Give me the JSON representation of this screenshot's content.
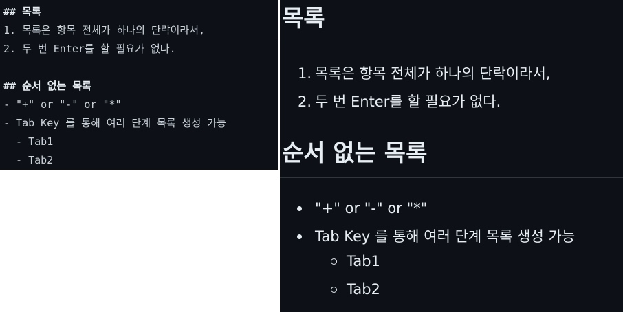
{
  "source": {
    "lines": [
      "## 목록",
      "1. 목록은 항목 전체가 하나의 단락이라서,",
      "2. 두 번 Enter를 할 필요가 없다.",
      "",
      "## 순서 없는 목록",
      "- \"+\" or \"-\" or \"*\"",
      "- Tab Key 를 통해 여러 단계 목록 생성 가능",
      "  - Tab1",
      "  - Tab2"
    ]
  },
  "preview": {
    "heading_ordered": "목록",
    "ordered_items": [
      {
        "num": "1.",
        "text": "목록은 항목 전체가 하나의 단락이라서,"
      },
      {
        "num": "2.",
        "text": "두 번 Enter를 할 필요가 없다."
      }
    ],
    "heading_unordered": "순서 없는 목록",
    "unordered_items": [
      {
        "text": "\"+\" or \"-\" or \"*\""
      },
      {
        "text": "Tab Key 를 통해 여러 단계 목록 생성 가능"
      }
    ],
    "sub_items": [
      {
        "text": "Tab1"
      },
      {
        "text": "Tab2"
      }
    ]
  }
}
